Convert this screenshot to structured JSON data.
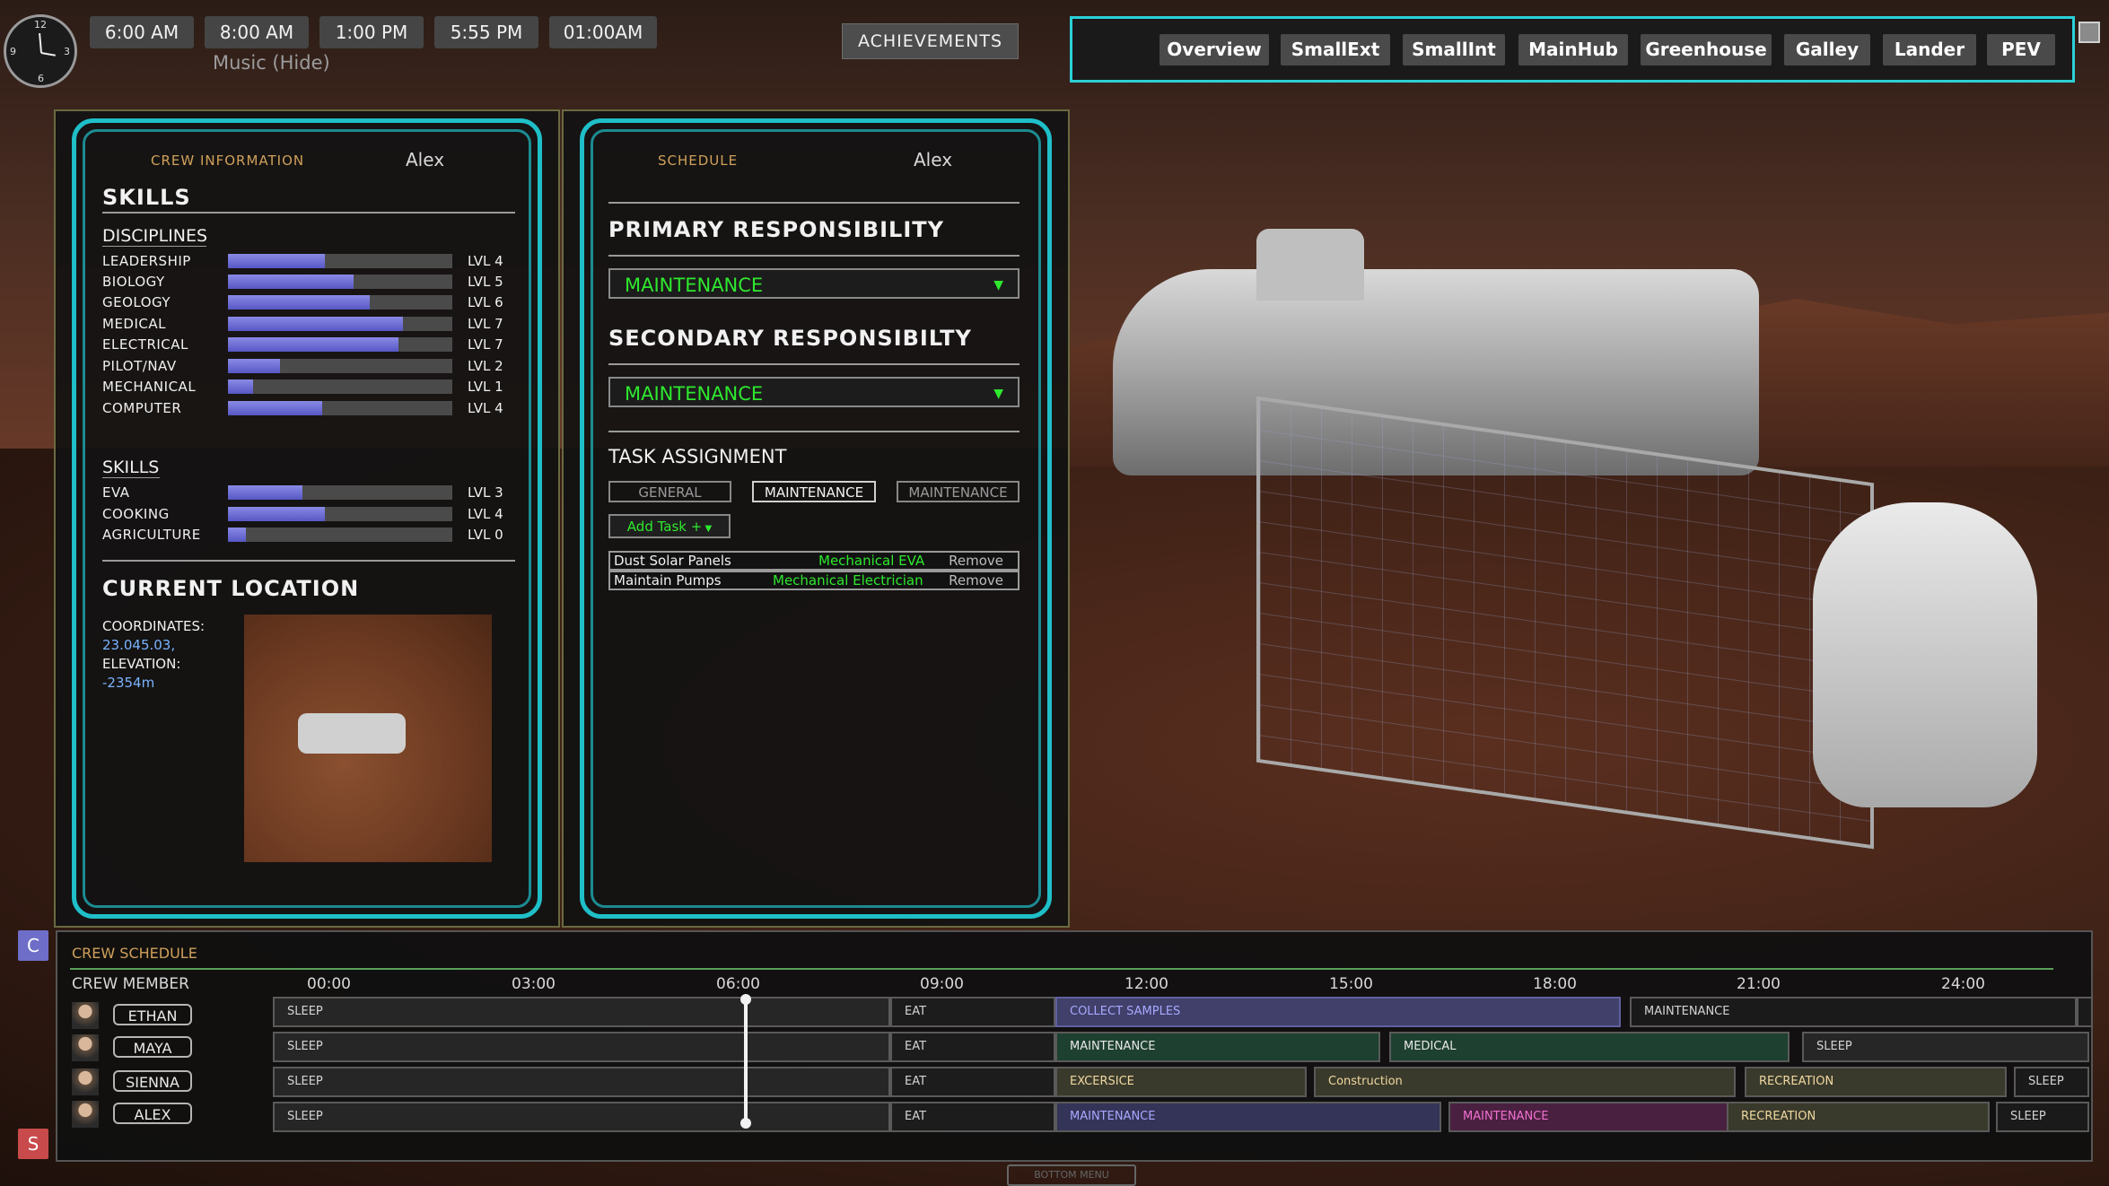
{
  "clock": {
    "numerals": [
      "12",
      "3",
      "6",
      "9"
    ]
  },
  "time_buttons": [
    "6:00 AM",
    "8:00 AM",
    "1:00 PM",
    "5:55 PM",
    "01:00AM"
  ],
  "music_label": "Music (Hide)",
  "achievements_label": "ACHIEVEMENTS",
  "locations": [
    "Overview",
    "SmallExt",
    "SmallInt",
    "MainHub",
    "Greenhouse",
    "Galley",
    "Lander",
    "PEV"
  ],
  "crew_panel": {
    "title": "CREW INFORMATION",
    "name": "Alex",
    "skills_heading": "SKILLS",
    "disciplines_heading": "DISCIPLINES",
    "disciplines": [
      {
        "label": "LEADERSHIP",
        "level_text": "LVL  4",
        "fill": 0.43
      },
      {
        "label": "BIOLOGY",
        "level_text": "LVL  5",
        "fill": 0.56
      },
      {
        "label": "GEOLOGY",
        "level_text": "LVL  6",
        "fill": 0.63
      },
      {
        "label": "MEDICAL",
        "level_text": "LVL  7",
        "fill": 0.78
      },
      {
        "label": "ELECTRICAL",
        "level_text": "LVL  7",
        "fill": 0.76
      },
      {
        "label": "PILOT/NAV",
        "level_text": "LVL  2",
        "fill": 0.23
      },
      {
        "label": "MECHANICAL",
        "level_text": "LVL  1",
        "fill": 0.11
      },
      {
        "label": "COMPUTER",
        "level_text": "LVL  4",
        "fill": 0.42
      }
    ],
    "skills_sub_heading": "SKILLS",
    "skills": [
      {
        "label": "EVA",
        "level_text": "LVL  3",
        "fill": 0.33
      },
      {
        "label": "COOKING",
        "level_text": "LVL  4",
        "fill": 0.43
      },
      {
        "label": "AGRICULTURE",
        "level_text": "LVL  0",
        "fill": 0.08
      }
    ],
    "location_heading": "CURRENT LOCATION",
    "coordinates_label": "COORDINATES:",
    "coordinates_value": "23.045.03,",
    "elevation_label": "ELEVATION:",
    "elevation_value": "-2354m"
  },
  "schedule_panel": {
    "title": "SCHEDULE",
    "name": "Alex",
    "primary_heading": "PRIMARY RESPONSIBILITY",
    "primary_value": "MAINTENANCE",
    "secondary_heading": "SECONDARY RESPONSIBILTY",
    "secondary_value": "MAINTENANCE",
    "task_heading": "TASK ASSIGNMENT",
    "task_tabs": [
      "GENERAL",
      "MAINTENANCE",
      "MAINTENANCE"
    ],
    "add_task_label": "Add Task +",
    "tasks": [
      {
        "name": "Dust Solar Panels",
        "tags": "Mechanical  EVA",
        "remove": "Remove"
      },
      {
        "name": "Maintain Pumps",
        "tags": "Mechanical  Electrician",
        "remove": "Remove"
      }
    ]
  },
  "crew_schedule": {
    "heading": "CREW SCHEDULE",
    "column_header": "CREW MEMBER",
    "times": [
      "00:00",
      "03:00",
      "06:00",
      "09:00",
      "12:00",
      "15:00",
      "18:00",
      "21:00",
      "24:00"
    ],
    "members": [
      {
        "name": "ETHAN",
        "blocks": [
          "SLEEP",
          "EAT",
          "COLLECT SAMPLES",
          "MAINTENANCE",
          ""
        ]
      },
      {
        "name": "MAYA",
        "blocks": [
          "SLEEP",
          "EAT",
          "MAINTENANCE",
          "MEDICAL",
          "SLEEP"
        ]
      },
      {
        "name": "SIENNA",
        "blocks": [
          "SLEEP",
          "EAT",
          "EXCERSICE",
          "Construction",
          "RECREATION",
          "SLEEP"
        ]
      },
      {
        "name": "ALEX",
        "blocks": [
          "SLEEP",
          "EAT",
          "MAINTENANCE",
          "MAINTENANCE",
          "RECREATION",
          "SLEEP"
        ]
      }
    ]
  },
  "side_buttons": {
    "c": "C",
    "s": "S"
  },
  "bottom_menu_label": "BOTTOM MENU",
  "colors": {
    "accent_cyan": "#1fbfc8",
    "green_text": "#2ee82e",
    "orange_title": "#d0a05a"
  }
}
